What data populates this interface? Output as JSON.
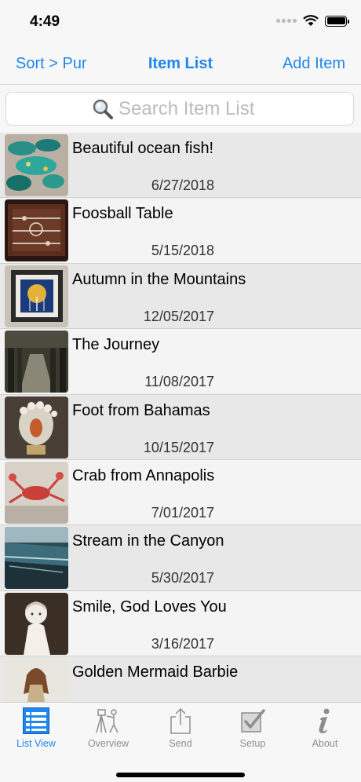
{
  "status": {
    "time": "4:49"
  },
  "nav": {
    "left": "Sort > Pur",
    "title": "Item List",
    "right": "Add Item"
  },
  "search": {
    "placeholder": "Search Item List"
  },
  "items": [
    {
      "title": "Beautiful ocean fish!",
      "date": "6/27/2018"
    },
    {
      "title": "Foosball Table",
      "date": "5/15/2018"
    },
    {
      "title": "Autumn in the Mountains",
      "date": "12/05/2017"
    },
    {
      "title": "The Journey",
      "date": "11/08/2017"
    },
    {
      "title": "Foot from Bahamas",
      "date": "10/15/2017"
    },
    {
      "title": "Crab from Annapolis",
      "date": "7/01/2017"
    },
    {
      "title": "Stream in the Canyon",
      "date": "5/30/2017"
    },
    {
      "title": "Smile, God Loves You",
      "date": "3/16/2017"
    },
    {
      "title": "Golden Mermaid Barbie",
      "date": ""
    }
  ],
  "tabs": [
    {
      "label": "List View",
      "icon": "list-view-icon",
      "active": true
    },
    {
      "label": "Overview",
      "icon": "tripod-icon",
      "active": false
    },
    {
      "label": "Send",
      "icon": "share-icon",
      "active": false
    },
    {
      "label": "Setup",
      "icon": "checkbox-icon",
      "active": false
    },
    {
      "label": "About",
      "icon": "info-icon",
      "active": false
    }
  ],
  "colors": {
    "accent": "#1f86f0",
    "inactive": "#8e8e8e"
  }
}
